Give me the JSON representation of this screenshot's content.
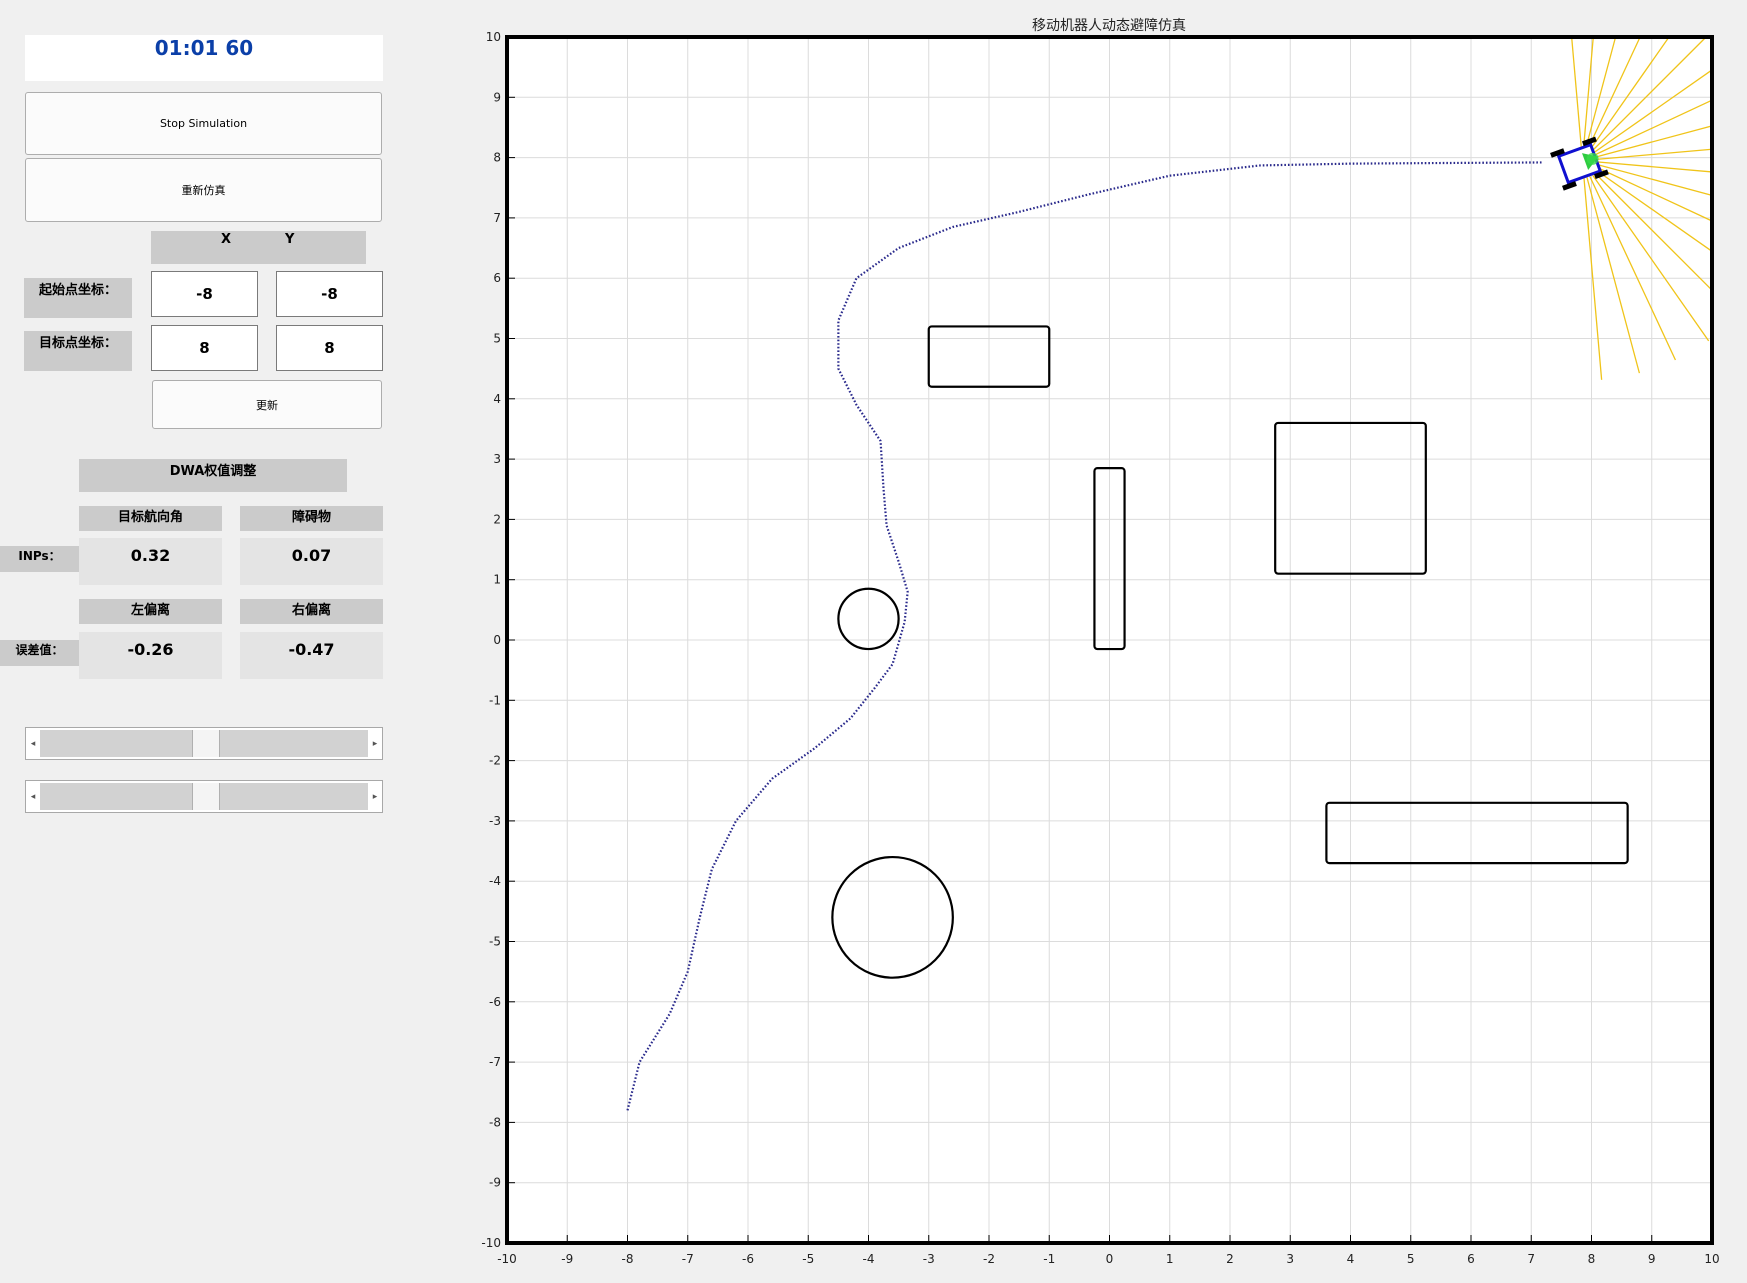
{
  "timer": "01:01 60",
  "buttons": {
    "stop": "Stop Simulation",
    "restart": "重新仿真",
    "update": "更新"
  },
  "coords": {
    "col_x": "X",
    "col_y": "Y",
    "start_label": "起始点坐标：",
    "goal_label": "目标点坐标：",
    "start_x": "-8",
    "start_y": "-8",
    "goal_x": "8",
    "goal_y": "8"
  },
  "dwa": {
    "title": "DWA权值调整",
    "heading_label": "目标航向角",
    "obstacle_label": "障碍物",
    "inps_label": "INPs：",
    "heading_value": "0.32",
    "obstacle_value": "0.07",
    "left_label": "左偏离",
    "right_label": "右偏离",
    "error_label": "误差值：",
    "left_value": "-0.26",
    "right_value": "-0.47"
  },
  "sliders": [
    {
      "value": 0.5
    },
    {
      "value": 0.5
    }
  ],
  "plot": {
    "title": "移动机器人动态避障仿真",
    "xlim": [
      -10,
      10
    ],
    "ylim": [
      -10,
      10
    ],
    "xticks": [
      "-10",
      "-9",
      "-8",
      "-7",
      "-6",
      "-5",
      "-4",
      "-3",
      "-2",
      "-1",
      "0",
      "1",
      "2",
      "3",
      "4",
      "5",
      "6",
      "7",
      "8",
      "9",
      "10"
    ],
    "yticks": [
      "10",
      "9",
      "8",
      "7",
      "6",
      "5",
      "4",
      "3",
      "2",
      "1",
      "0",
      "-1",
      "-2",
      "-3",
      "-4",
      "-5",
      "-6",
      "-7",
      "-8",
      "-9",
      "-10"
    ],
    "grid": true,
    "obstacles": {
      "rects": [
        {
          "x1": -3.0,
          "y1": 4.2,
          "x2": -1.0,
          "y2": 5.2
        },
        {
          "x1": -0.25,
          "y1": -0.15,
          "x2": 0.25,
          "y2": 2.85
        },
        {
          "x1": 2.75,
          "y1": 1.1,
          "x2": 5.25,
          "y2": 3.6
        },
        {
          "x1": 3.6,
          "y1": -3.7,
          "x2": 8.6,
          "y2": -2.7
        }
      ],
      "circles": [
        {
          "cx": -4.0,
          "cy": 0.35,
          "r": 0.5
        },
        {
          "cx": -3.6,
          "cy": -4.6,
          "r": 1.0
        }
      ]
    },
    "trajectory": [
      [
        -8.0,
        -7.8
      ],
      [
        -7.8,
        -7.0
      ],
      [
        -7.3,
        -6.2
      ],
      [
        -7.0,
        -5.5
      ],
      [
        -6.8,
        -4.6
      ],
      [
        -6.6,
        -3.8
      ],
      [
        -6.2,
        -3.0
      ],
      [
        -5.6,
        -2.3
      ],
      [
        -4.9,
        -1.8
      ],
      [
        -4.3,
        -1.3
      ],
      [
        -3.9,
        -0.8
      ],
      [
        -3.6,
        -0.4
      ],
      [
        -3.4,
        0.3
      ],
      [
        -3.35,
        0.8
      ],
      [
        -3.5,
        1.3
      ],
      [
        -3.7,
        1.9
      ],
      [
        -3.75,
        2.5
      ],
      [
        -3.8,
        3.3
      ],
      [
        -4.2,
        3.9
      ],
      [
        -4.5,
        4.5
      ],
      [
        -4.5,
        5.3
      ],
      [
        -4.2,
        6.0
      ],
      [
        -3.5,
        6.5
      ],
      [
        -2.6,
        6.85
      ],
      [
        -1.5,
        7.1
      ],
      [
        -0.3,
        7.4
      ],
      [
        1.0,
        7.7
      ],
      [
        2.5,
        7.87
      ],
      [
        4.0,
        7.9
      ],
      [
        5.5,
        7.91
      ],
      [
        7.2,
        7.92
      ]
    ],
    "robot": {
      "x": 7.8,
      "y": 7.9,
      "heading_deg": 20
    },
    "laser_color": "#f0c419",
    "path_color": "#2a2a8c"
  }
}
